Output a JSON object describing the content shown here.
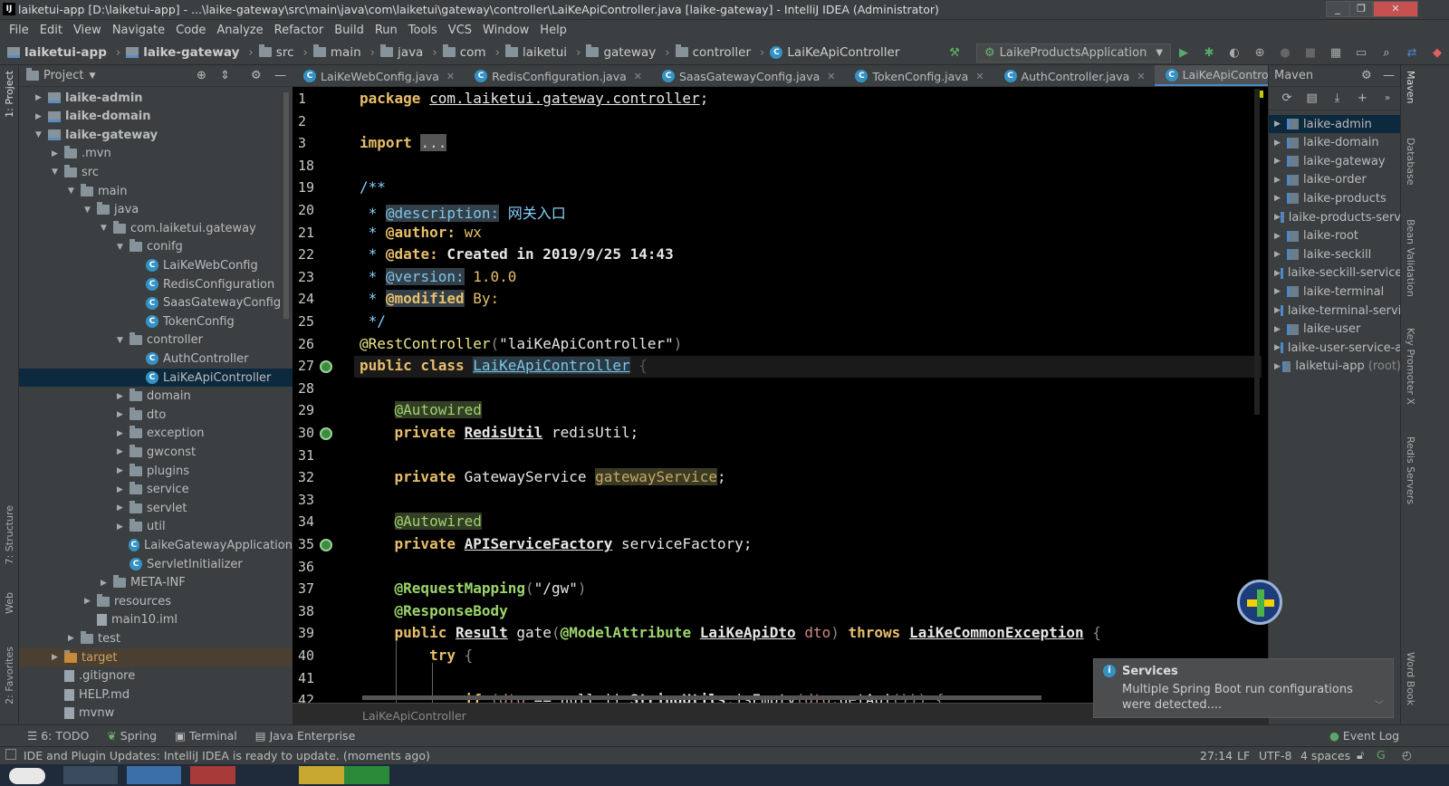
{
  "window": {
    "title": "laiketui-app [D:\\laiketui-app] - ...\\laike-gateway\\src\\main\\java\\com\\laiketui\\gateway\\controller\\LaiKeApiController.java [laike-gateway] - IntelliJ IDEA (Administrator)",
    "minimize": "_",
    "maximize": "❐",
    "close": "✕"
  },
  "menu": [
    "File",
    "Edit",
    "View",
    "Navigate",
    "Code",
    "Analyze",
    "Refactor",
    "Build",
    "Run",
    "Tools",
    "VCS",
    "Window",
    "Help"
  ],
  "breadcrumbs": [
    "laiketui-app",
    "laike-gateway",
    "src",
    "main",
    "java",
    "com",
    "laiketui",
    "gateway",
    "controller",
    "LaiKeApiController"
  ],
  "run_config": "LaikeProductsApplication",
  "project_panel": {
    "title": "Project",
    "tree": [
      {
        "label": "laike-admin",
        "depth": 0,
        "arrow": "▶",
        "icon": "module",
        "bold": true
      },
      {
        "label": "laike-domain",
        "depth": 0,
        "arrow": "▶",
        "icon": "module",
        "bold": true
      },
      {
        "label": "laike-gateway",
        "depth": 0,
        "arrow": "▼",
        "icon": "module",
        "bold": true
      },
      {
        "label": ".mvn",
        "depth": 1,
        "arrow": "▶",
        "icon": "folder"
      },
      {
        "label": "src",
        "depth": 1,
        "arrow": "▼",
        "icon": "folder"
      },
      {
        "label": "main",
        "depth": 2,
        "arrow": "▼",
        "icon": "folder"
      },
      {
        "label": "java",
        "depth": 3,
        "arrow": "▼",
        "icon": "folder"
      },
      {
        "label": "com.laiketui.gateway",
        "depth": 4,
        "arrow": "▼",
        "icon": "folder"
      },
      {
        "label": "conifg",
        "depth": 5,
        "arrow": "▼",
        "icon": "folder"
      },
      {
        "label": "LaiKeWebConfig",
        "depth": 6,
        "arrow": "",
        "icon": "class"
      },
      {
        "label": "RedisConfiguration",
        "depth": 6,
        "arrow": "",
        "icon": "class"
      },
      {
        "label": "SaasGatewayConfig",
        "depth": 6,
        "arrow": "",
        "icon": "class"
      },
      {
        "label": "TokenConfig",
        "depth": 6,
        "arrow": "",
        "icon": "class"
      },
      {
        "label": "controller",
        "depth": 5,
        "arrow": "▼",
        "icon": "folder"
      },
      {
        "label": "AuthController",
        "depth": 6,
        "arrow": "",
        "icon": "class"
      },
      {
        "label": "LaiKeApiController",
        "depth": 6,
        "arrow": "",
        "icon": "class",
        "selected": true
      },
      {
        "label": "domain",
        "depth": 5,
        "arrow": "▶",
        "icon": "folder"
      },
      {
        "label": "dto",
        "depth": 5,
        "arrow": "▶",
        "icon": "folder"
      },
      {
        "label": "exception",
        "depth": 5,
        "arrow": "▶",
        "icon": "folder"
      },
      {
        "label": "gwconst",
        "depth": 5,
        "arrow": "▶",
        "icon": "folder"
      },
      {
        "label": "plugins",
        "depth": 5,
        "arrow": "▶",
        "icon": "folder"
      },
      {
        "label": "service",
        "depth": 5,
        "arrow": "▶",
        "icon": "folder"
      },
      {
        "label": "servlet",
        "depth": 5,
        "arrow": "▶",
        "icon": "folder"
      },
      {
        "label": "util",
        "depth": 5,
        "arrow": "▶",
        "icon": "folder"
      },
      {
        "label": "LaikeGatewayApplication",
        "depth": 5,
        "arrow": "",
        "icon": "class"
      },
      {
        "label": "ServletInitializer",
        "depth": 5,
        "arrow": "",
        "icon": "class"
      },
      {
        "label": "META-INF",
        "depth": 4,
        "arrow": "▶",
        "icon": "folder"
      },
      {
        "label": "resources",
        "depth": 3,
        "arrow": "▶",
        "icon": "folder"
      },
      {
        "label": "main10.iml",
        "depth": 3,
        "arrow": "",
        "icon": "file"
      },
      {
        "label": "test",
        "depth": 2,
        "arrow": "▶",
        "icon": "folder"
      },
      {
        "label": "target",
        "depth": 1,
        "arrow": "▶",
        "icon": "folder-orange"
      },
      {
        "label": ".gitignore",
        "depth": 1,
        "arrow": "",
        "icon": "file"
      },
      {
        "label": "HELP.md",
        "depth": 1,
        "arrow": "",
        "icon": "file"
      },
      {
        "label": "mvnw",
        "depth": 1,
        "arrow": "",
        "icon": "file"
      }
    ]
  },
  "editor_tabs": [
    {
      "label": "LaiKeWebConfig.java"
    },
    {
      "label": "RedisConfiguration.java"
    },
    {
      "label": "SaasGatewayConfig.java"
    },
    {
      "label": "TokenConfig.java"
    },
    {
      "label": "AuthController.java"
    },
    {
      "label": "LaiKeApiController.java",
      "active": true
    }
  ],
  "code_lines": [
    {
      "n": "1",
      "html": "<span class=\"kw\">package</span> <span class=\"und\">com.laiketui.gateway.controller</span>;"
    },
    {
      "n": "2",
      "html": ""
    },
    {
      "n": "3",
      "html": "<span class=\"kw\">import</span> <span style=\"background:#555;color:#ccc\">...</span>"
    },
    {
      "n": "18",
      "html": ""
    },
    {
      "n": "19",
      "html": "<span class=\"doc\">/**</span>"
    },
    {
      "n": "20",
      "html": "<span class=\"doc\"> * </span><span class=\"ann\" style=\"color:#7ec5e6;background:#33404a\">@description:</span><span class=\"doc\"> 网关入口</span>"
    },
    {
      "n": "21",
      "html": "<span class=\"doc\"> * </span><span style=\"color:#e8bf6a;font-weight:bold\">@author:</span><span class=\"doc\" style=\"color:#e8bf6a\"> wx</span>"
    },
    {
      "n": "22",
      "html": "<span class=\"doc\"> * </span><span style=\"color:#e8bf6a;font-weight:bold\">@date:</span><span style=\"color:#e6e6e6;font-weight:bold\"> Created in 2019/9/25 14:43</span>"
    },
    {
      "n": "23",
      "html": "<span class=\"doc\"> * </span><span style=\"color:#7ec5e6;background:#33404a\">@version:</span><span style=\"color:#e8bf6a\"> 1.0.0</span>"
    },
    {
      "n": "24",
      "html": "<span class=\"doc\"> * </span><span style=\"color:#e8bf6a;font-weight:bold;background:#33404a\">@modified</span><span style=\"color:#e8bf6a\"> By:</span>"
    },
    {
      "n": "25",
      "html": "<span class=\"doc\"> */</span>"
    },
    {
      "n": "26",
      "html": "<span style=\"color:#f0e68c\">@RestController</span><span style=\"color:#888\">(</span><span style=\"color:#e6e6e6\">\"laiKeApiController\"</span><span style=\"color:#888\">)</span>"
    },
    {
      "n": "27",
      "html": "<span class=\"kw\">public class</span> <span class=\"und\" style=\"color:#7ec5e6;background:#2a3a44\">LaiKeApiController</span> <span style=\"color:#555\">{</span>"
    },
    {
      "n": "28",
      "html": ""
    },
    {
      "n": "29",
      "html": "    <span class=\"ann\">@Autowired</span>"
    },
    {
      "n": "30",
      "html": "    <span class=\"kw\">private</span> <span class=\"und\" style=\"font-weight:bold\">RedisUtil</span> redisUtil;"
    },
    {
      "n": "31",
      "html": ""
    },
    {
      "n": "32",
      "html": "    <span class=\"kw\">private</span> GatewayService <span class=\"hl\" style=\"color:#c8a860\">gatewayService</span>;"
    },
    {
      "n": "33",
      "html": ""
    },
    {
      "n": "34",
      "html": "    <span class=\"ann\">@Autowired</span>"
    },
    {
      "n": "35",
      "html": "    <span class=\"kw\">private</span> <span class=\"und\" style=\"font-weight:bold\">APIServiceFactory</span> serviceFactory;"
    },
    {
      "n": "36",
      "html": ""
    },
    {
      "n": "37",
      "html": "    <span style=\"color:#9cd46c;font-weight:bold\">@RequestMapping</span><span style=\"color:#888\">(</span><span style=\"color:#e6e6e6\">\"/gw\"</span><span style=\"color:#888\">)</span>"
    },
    {
      "n": "38",
      "html": "    <span style=\"color:#9cd46c;font-weight:bold\">@ResponseBody</span>"
    },
    {
      "n": "39",
      "html": "    <span class=\"kw\">public</span> <span class=\"und\" style=\"font-weight:bold\">Result</span> gate<span style=\"color:#888\">(</span><span style=\"color:#9cd46c;font-weight:bold\">@ModelAttribute</span> <span class=\"und\" style=\"font-weight:bold\">LaiKeApiDto</span> <span style=\"color:#c88\">dto</span><span style=\"color:#888\">)</span> <span class=\"kw\">throws</span> <span class=\"und\" style=\"font-weight:bold\">LaiKeCommonException</span> <span style=\"color:#888\">{</span>"
    },
    {
      "n": "40",
      "html": "        <span class=\"kw\">try</span> <span style=\"color:#888\">{</span>"
    },
    {
      "n": "41",
      "html": ""
    },
    {
      "n": "42",
      "html": "            <span class=\"kw\">if</span> <span style=\"color:#888\">(</span><span style=\"color:#c88\">dto</span> == null || <span class=\"und\" style=\"font-weight:bold\">StringUtils</span>.<span class=\"und\">isEmpty</span><span style=\"color:#888\">(</span><span style=\"color:#c88\">dto</span>.getApi<span style=\"color:#888\">()))</span> <span style=\"color:#888\">{</span>"
    }
  ],
  "editor_breadcrumb": "LaiKeApiController",
  "maven_panel": {
    "title": "Maven",
    "items": [
      {
        "label": "laike-admin",
        "selected": true
      },
      {
        "label": "laike-domain"
      },
      {
        "label": "laike-gateway"
      },
      {
        "label": "laike-order"
      },
      {
        "label": "laike-products"
      },
      {
        "label": "laike-products-serv"
      },
      {
        "label": "laike-root"
      },
      {
        "label": "laike-seckill"
      },
      {
        "label": "laike-seckill-service"
      },
      {
        "label": "laike-terminal"
      },
      {
        "label": "laike-terminal-servi"
      },
      {
        "label": "laike-user"
      },
      {
        "label": "laike-user-service-a"
      },
      {
        "label": "laiketui-app",
        "suffix": "(root)"
      }
    ]
  },
  "left_stripe": {
    "project": "1: Project",
    "structure": "7: Structure",
    "web": "Web",
    "favorites": "2: Favorites"
  },
  "right_stripe": {
    "maven": "Maven",
    "database": "Database",
    "bean": "Bean Validation",
    "key": "Key Promoter X",
    "redis": "Redis Servers",
    "word": "Word Book"
  },
  "tool_windows": [
    "6: TODO",
    "Spring",
    "Terminal",
    "Java Enterprise"
  ],
  "event_log": "Event Log",
  "status": {
    "message": "IDE and Plugin Updates: IntelliJ IDEA is ready to update. (moments ago)",
    "position": "27:14",
    "line_sep": "LF",
    "encoding": "UTF-8",
    "indent": "4 spaces"
  },
  "notification": {
    "title": "Services",
    "body_line1": "Multiple Spring Boot run configurations",
    "body_line2": "were detected...."
  },
  "colors": {
    "accent": "#4a88c7",
    "selected": "#0d293e",
    "editor_bg": "#000000",
    "panel_bg": "#3c3f41"
  }
}
